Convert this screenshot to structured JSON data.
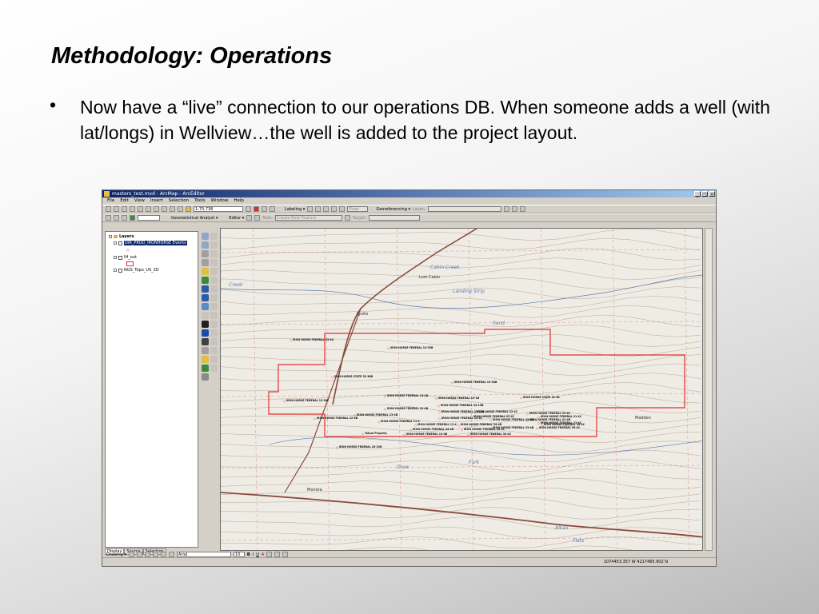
{
  "slide": {
    "title": "Methodology: Operations",
    "bullet_symbol": "•",
    "bullet_text": "Now have a “live” connection to our operations DB.  When someone adds a well (with lat/longs) in Wellview…the well is added to the project layout."
  },
  "window": {
    "title": "masters_test.mxd - ArcMap - ArcEditor",
    "controls": [
      "_",
      "□",
      "×"
    ],
    "menu": [
      "File",
      "Edit",
      "View",
      "Insert",
      "Selection",
      "Tools",
      "Window",
      "Help"
    ],
    "toolbar1": {
      "scale": "1:70,738",
      "labeling": "Labeling ▾",
      "font_size_combo": "Float",
      "georeferencing": "Georeferencing ▾",
      "layer_label": "Layer:"
    },
    "toolbar2": {
      "geostat": "Geostatistical Analyst ▾",
      "editor": "Editor ▾",
      "task_label": "Task:",
      "task_value": "Create New Feature",
      "target_label": "Target:"
    },
    "toc": {
      "root": "Layers",
      "layers": [
        {
          "name": "DIR_PROD_IRONHORSE Events",
          "selected": true
        },
        {
          "name": "IH_out",
          "selected": false
        },
        {
          "name": "NGS_Topo_US_2D",
          "selected": false
        }
      ],
      "tabs": [
        "Display",
        "Source",
        "Selection"
      ]
    },
    "draw": {
      "drawing": "Drawing ▾",
      "font": "Arial",
      "size": "10",
      "bold": "B",
      "italic": "I",
      "underline": "U",
      "fontcolor": "A"
    },
    "status": {
      "coords": "1074453.357 W  4217485.902 N"
    }
  },
  "map": {
    "places": [
      "Lost Cabin",
      "Lysite",
      "Madden",
      "Moneta",
      "Creek",
      "Alkali",
      "Flats",
      "Drew",
      "Fork",
      "Sand",
      "Cabin Creek",
      "Landing Strip"
    ],
    "wells": [
      "IRON HORSE FEDERAL 33-34",
      "IRON HORSE FEDERAL 13-35B",
      "IRON HORSE FEDERAL 13-34B",
      "IRON HORSE STATE 32-36B",
      "IRON HORSE FEDERAL 13-36C",
      "IRON HORSE FEDERAL 13-1B",
      "IRON HORSE FEDERAL 15-1B",
      "IRON HORSE FEDERAL 34-13B",
      "IRON HORSE FEDERAL 33-12B",
      "IRON HORSE STATE 12-36",
      "IRON HORSE FEDERAL 22-4C",
      "IRON HORSE FEDERAL 32-4C",
      "IRON HORSE FEDERAL 41-4C",
      "IRON HORSE FEDERAL 14-4C",
      "IRON HORSE FEDERAL 22-4B",
      "IRON HORSE FEDERAL 23-4B",
      "IRON HORSE FEDERAL 32-4B",
      "IRON HORSE FEDERAL 11-4",
      "IRON HORSE FEDERAL 12-4",
      "IRON HORSE FEDERAL 21-4C",
      "IRON HORSE FEDERAL 43-4B",
      "IRON HORSE FEDERAL 41-4B",
      "IRON HORSE FEDERAL 23-4C",
      "IRON HORSE FEDERAL 33-4C",
      "IRON HORSE FEDERAL 33-4B",
      "IRON HORSE FEDERAL 44-4C",
      "IRON HORSE FEDERAL 34-4B",
      "IRON HORSE FEDERAL 42-4C",
      "IRON HORSE FEDERAL 44-4B",
      "IRON HORSE FEDERAL 34-4C",
      "IRON HORSE FEDERAL 43-10D",
      "Tatum Property",
      "IRON HORSE FEDERAL 13-4B"
    ],
    "colors": {
      "boundary": "#e03030",
      "road": "#8b4a3a",
      "water": "#5a7ab0",
      "contour": "#b8a890"
    }
  }
}
